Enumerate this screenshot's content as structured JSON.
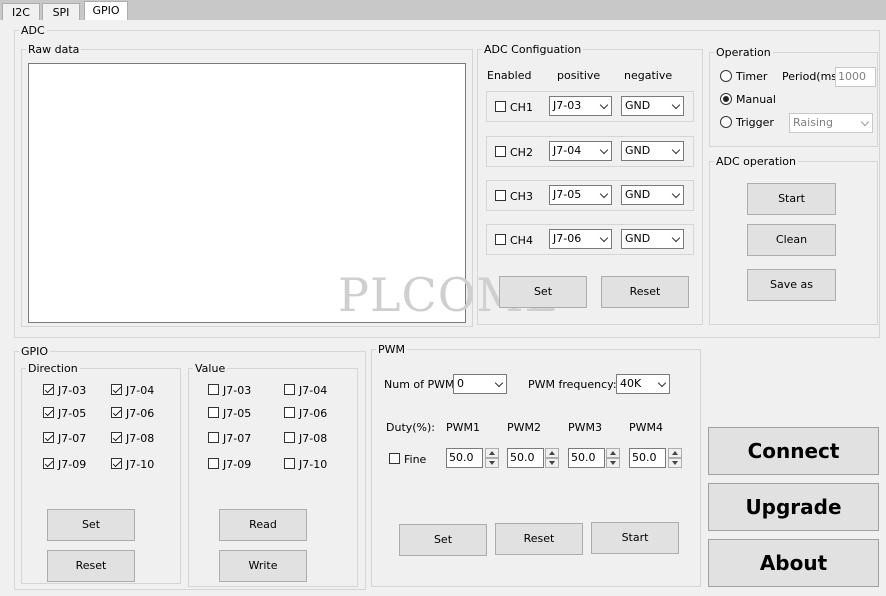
{
  "tabs": [
    {
      "label": "I2C"
    },
    {
      "label": "SPI"
    },
    {
      "label": "GPIO"
    }
  ],
  "adc": {
    "title": "ADC",
    "raw_data": {
      "title": "Raw data",
      "text": ""
    },
    "config": {
      "title": "ADC Configuation",
      "headers": {
        "enabled": "Enabled",
        "positive": "positive",
        "negative": "negative"
      },
      "channels": [
        {
          "label": "CH1",
          "checked": false,
          "positive": "J7-03",
          "negative": "GND"
        },
        {
          "label": "CH2",
          "checked": false,
          "positive": "J7-04",
          "negative": "GND"
        },
        {
          "label": "CH3",
          "checked": false,
          "positive": "J7-05",
          "negative": "GND"
        },
        {
          "label": "CH4",
          "checked": false,
          "positive": "J7-06",
          "negative": "GND"
        }
      ],
      "set_label": "Set",
      "reset_label": "Reset"
    },
    "operation": {
      "title": "Operation",
      "timer_label": "Timer",
      "period_label": "Period(ms)",
      "period_value": "1000",
      "manual_label": "Manual",
      "trigger_label": "Trigger",
      "trigger_value": "Raising",
      "selected": "manual"
    },
    "adc_operation": {
      "title": "ADC operation",
      "start_label": "Start",
      "clean_label": "Clean",
      "save_label": "Save as"
    }
  },
  "watermark": "PLCOME",
  "gpio": {
    "title": "GPIO",
    "direction": {
      "title": "Direction",
      "pins": [
        {
          "label": "J7-03",
          "checked": true
        },
        {
          "label": "J7-04",
          "checked": true
        },
        {
          "label": "J7-05",
          "checked": true
        },
        {
          "label": "J7-06",
          "checked": true
        },
        {
          "label": "J7-07",
          "checked": true
        },
        {
          "label": "J7-08",
          "checked": true
        },
        {
          "label": "J7-09",
          "checked": true
        },
        {
          "label": "J7-10",
          "checked": true
        }
      ],
      "set_label": "Set",
      "reset_label": "Reset"
    },
    "value": {
      "title": "Value",
      "pins": [
        {
          "label": "J7-03",
          "checked": false
        },
        {
          "label": "J7-04",
          "checked": false
        },
        {
          "label": "J7-05",
          "checked": false
        },
        {
          "label": "J7-06",
          "checked": false
        },
        {
          "label": "J7-07",
          "checked": false
        },
        {
          "label": "J7-08",
          "checked": false
        },
        {
          "label": "J7-09",
          "checked": false
        },
        {
          "label": "J7-10",
          "checked": false
        }
      ],
      "read_label": "Read",
      "write_label": "Write"
    }
  },
  "pwm": {
    "title": "PWM",
    "num_label": "Num of PWM:",
    "num_value": "0",
    "freq_label": "PWM frequency:",
    "freq_value": "40K",
    "duty_label": "Duty(%):",
    "fine_label": "Fine",
    "fine_checked": false,
    "channels": [
      {
        "label": "PWM1",
        "value": "50.0"
      },
      {
        "label": "PWM2",
        "value": "50.0"
      },
      {
        "label": "PWM3",
        "value": "50.0"
      },
      {
        "label": "PWM4",
        "value": "50.0"
      }
    ],
    "set_label": "Set",
    "reset_label": "Reset",
    "start_label": "Start"
  },
  "actions": {
    "connect_label": "Connect",
    "upgrade_label": "Upgrade",
    "about_label": "About"
  }
}
